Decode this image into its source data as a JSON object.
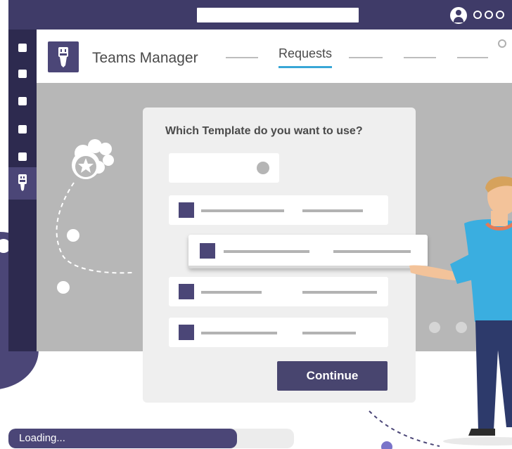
{
  "window": {
    "titlebar_color": "#3f3b68",
    "search_icon": "search-bar",
    "avatar_icon": "user-avatar-icon",
    "more_icon": "more-dots-icon"
  },
  "rail": {
    "active_app_icon": "teams-manager-icon",
    "items": [
      "rail-item-1",
      "rail-item-2",
      "rail-item-3",
      "rail-item-4",
      "rail-item-5"
    ]
  },
  "header": {
    "app_title": "Teams Manager",
    "active_tab": "Requests",
    "accent_color": "#38a6d6"
  },
  "dialog": {
    "question": "Which Template do you want to use?",
    "continue_label": "Continue"
  },
  "loading": {
    "label": "Loading...",
    "progress": 0.8
  },
  "colors": {
    "brand": "#4b4677",
    "content_bg": "#b7b7b7",
    "shirt": "#3aaee0"
  }
}
